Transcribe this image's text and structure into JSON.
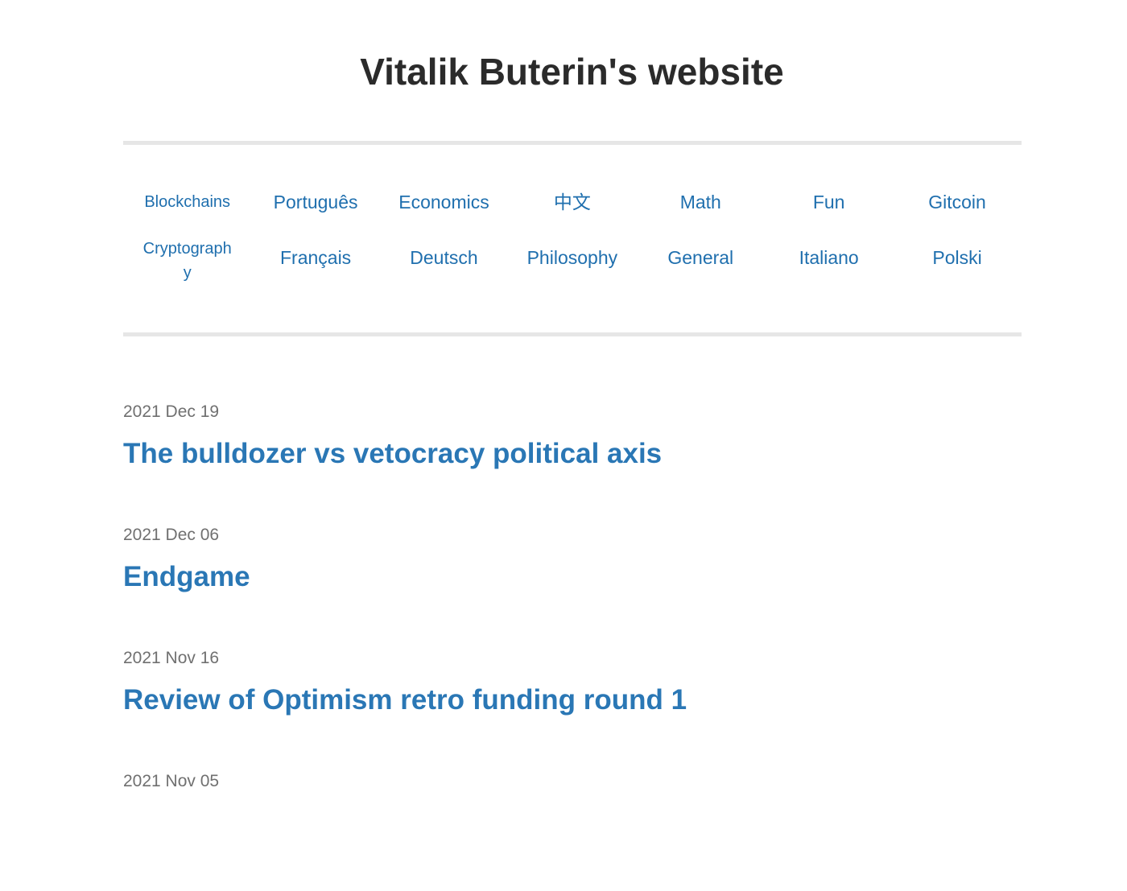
{
  "site": {
    "title": "Vitalik Buterin's website"
  },
  "categories": {
    "row1": [
      "Blockchains",
      "Português",
      "Economics",
      "中文",
      "Math",
      "Fun",
      "Gitcoin"
    ],
    "row2": [
      "Cryptography",
      "Français",
      "Deutsch",
      "Philosophy",
      "General",
      "Italiano",
      "Polski"
    ]
  },
  "posts": [
    {
      "date": "2021 Dec 19",
      "title": "The bulldozer vs vetocracy political axis"
    },
    {
      "date": "2021 Dec 06",
      "title": "Endgame"
    },
    {
      "date": "2021 Nov 16",
      "title": "Review of Optimism retro funding round 1"
    },
    {
      "date": "2021 Nov 05",
      "title": ""
    }
  ],
  "colors": {
    "link": "#1f6fae",
    "post_title": "#2a77b5",
    "date": "#707070",
    "rule": "#e6e6e6"
  }
}
